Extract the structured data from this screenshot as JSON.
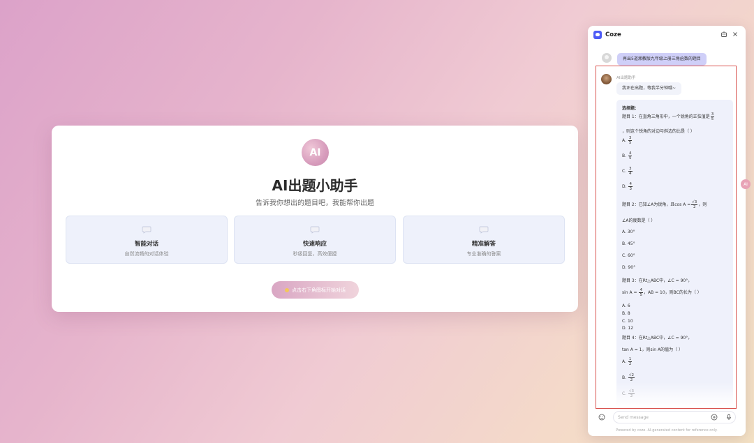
{
  "main": {
    "logo_text": "AI",
    "title": "AI出题小助手",
    "subtitle": "告诉我你想出的题目吧，我能帮你出题",
    "features": [
      {
        "name": "智能对话",
        "desc": "自然流畅的对话体验",
        "icon": "chat-bubble-icon"
      },
      {
        "name": "快速响应",
        "desc": "秒级回复，高效便捷",
        "icon": "chat-bubble-icon"
      },
      {
        "name": "精准解答",
        "desc": "专业准确的答案",
        "icon": "chat-bubble-icon"
      }
    ],
    "start_button": "点击右下角图标开始对话"
  },
  "chat_panel": {
    "title": "Coze",
    "user_message": "再出5道湘教版九年级上册三角函数的题目",
    "bot_name": "AI出题助手",
    "bot_message": "我正在出题，等我半分钟哦~",
    "answer": {
      "section": "选择题：",
      "q1_prefix": "题目 1：在直角三角形中，一个锐角的正弦值是",
      "q1_frac": {
        "n": "3",
        "d": "5"
      },
      "q1_suffix": "，则这个锐角的对边与斜边的比是（ ）",
      "q1_options": [
        {
          "label": "A.",
          "n": "3",
          "d": "5"
        },
        {
          "label": "B.",
          "n": "4",
          "d": "5"
        },
        {
          "label": "C.",
          "n": "3",
          "d": "4"
        },
        {
          "label": "D.",
          "n": "4",
          "d": "3"
        }
      ],
      "q2_prefix": "题目 2：已知∠A为锐角，且cos A =",
      "q2_frac": {
        "n": "√3",
        "d": "2"
      },
      "q2_suffix": "，则",
      "q2_line2": "∠A的度数是（ ）",
      "q2_options": [
        "A. 30°",
        "B. 45°",
        "C. 60°",
        "D. 90°"
      ],
      "q3_line1": "题目 3：在Rt△ABC中，∠C = 90°，",
      "q3_line2_prefix": "sin A =",
      "q3_frac": {
        "n": "4",
        "d": "5"
      },
      "q3_line2_suffix": "，AB = 10，则BC的长为（ ）",
      "q3_options": [
        "A. 6",
        "B. 8",
        "C. 10",
        "D. 12"
      ],
      "q4_line1": "题目 4：在Rt△ABC中，∠C = 90°，",
      "q4_line2": "tan A = 1，则sin A的值为（ ）",
      "q4_options": [
        {
          "label": "A.",
          "n": "1",
          "d": "2"
        },
        {
          "label": "B.",
          "n": "√2",
          "d": "2"
        },
        {
          "label": "C.",
          "n": "√3",
          "d": "2"
        }
      ]
    },
    "side_badge": "AI",
    "input_placeholder": "Send message",
    "footer": "Powered by coze. AI-generated content for reference only."
  }
}
